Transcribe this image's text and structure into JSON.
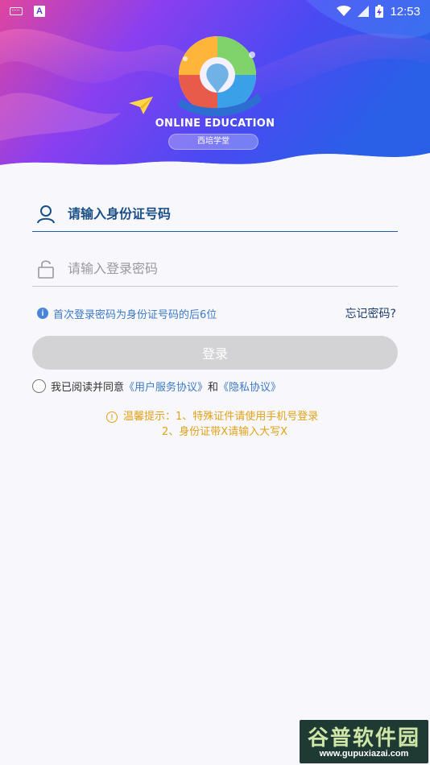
{
  "status_bar": {
    "time": "12:53",
    "icons": [
      "keyboard-icon",
      "a-icon",
      "wifi-icon",
      "no-sim-icon",
      "battery-charging-icon"
    ]
  },
  "header": {
    "brand_title": "ONLINE EDUCATION",
    "brand_subtitle": "西培学堂",
    "colors": {
      "gradient_start": "#e0459f",
      "gradient_mid": "#7a3df0",
      "gradient_end": "#2a5fe8"
    }
  },
  "form": {
    "id_field": {
      "placeholder": "请输入身份证号码",
      "value": "",
      "icon": "user-icon"
    },
    "password_field": {
      "placeholder": "请输入登录密码",
      "value": "",
      "icon": "lock-icon"
    },
    "hint": "首次登录密码为身份证号码的后6位",
    "forgot_label": "忘记密码?",
    "login_label": "登录"
  },
  "agreement": {
    "prefix": "我已阅读并同意",
    "user_agreement": "《用户服务协议》",
    "and": "和",
    "privacy": "《隐私协议》",
    "checked": false
  },
  "tips": {
    "line1": "温馨提示：1、特殊证件请使用手机号登录",
    "line2": "2、身份证带X请输入大写X"
  },
  "watermark": {
    "title": "谷普软件园",
    "url": "www.gupuxiazai.com"
  }
}
